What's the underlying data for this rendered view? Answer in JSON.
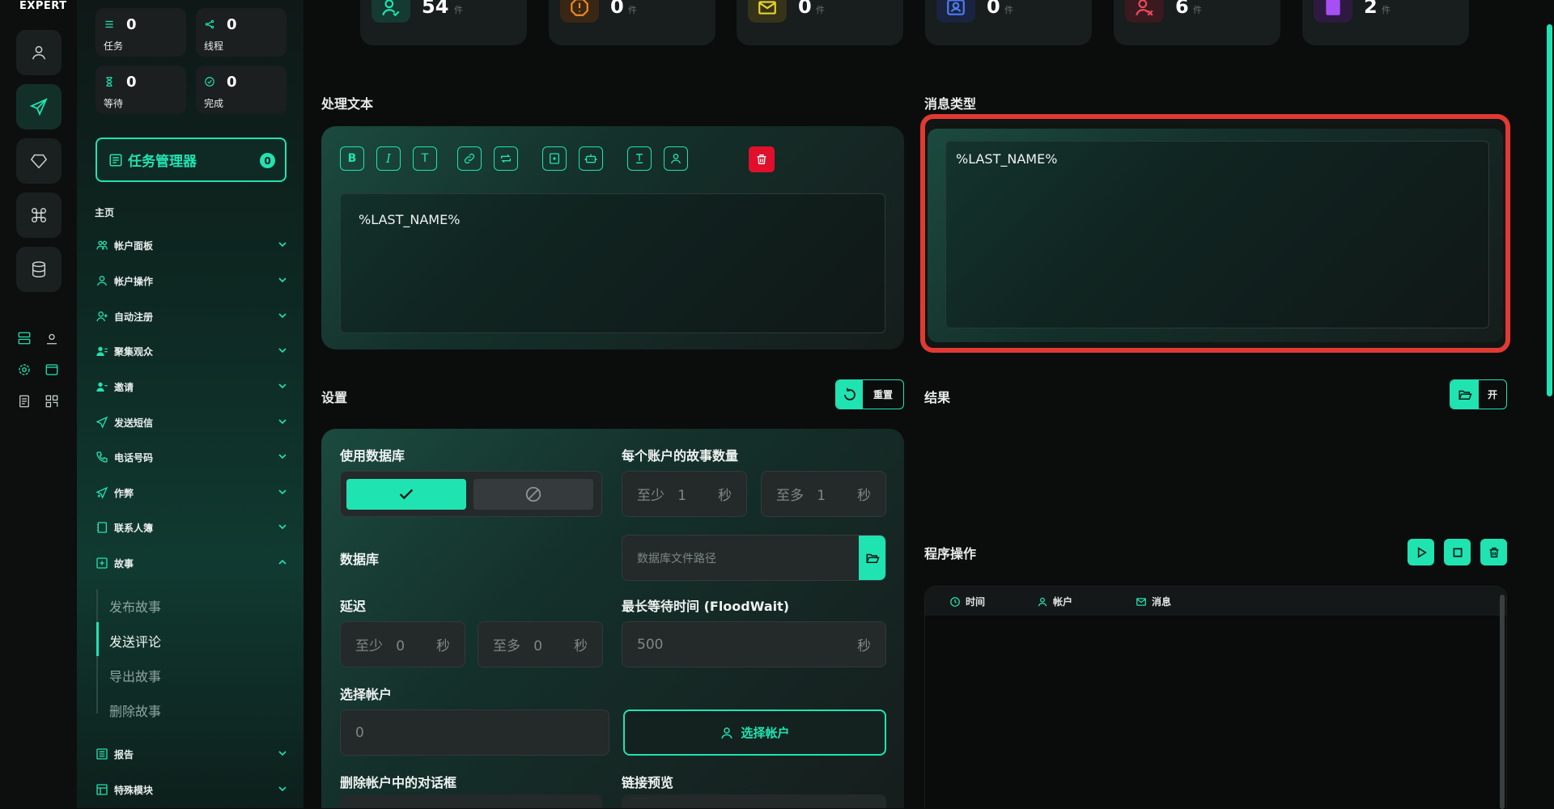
{
  "brand": "EXPERT",
  "sidebar_stats": [
    {
      "value": "0",
      "label": "任务"
    },
    {
      "value": "0",
      "label": "线程"
    },
    {
      "value": "0",
      "label": "等待"
    },
    {
      "value": "0",
      "label": "完成"
    }
  ],
  "task_manager": {
    "label": "任务管理器",
    "badge": "0"
  },
  "nav": {
    "home_label": "主页",
    "items": [
      {
        "label": "帐户面板"
      },
      {
        "label": "帐户操作"
      },
      {
        "label": "自动注册"
      },
      {
        "label": "聚集观众"
      },
      {
        "label": "邀请"
      },
      {
        "label": "发送短信"
      },
      {
        "label": "电话号码"
      },
      {
        "label": "作弊"
      },
      {
        "label": "联系人簿"
      },
      {
        "label": "故事"
      }
    ],
    "story_sub": [
      {
        "label": "发布故事"
      },
      {
        "label": "发送评论"
      },
      {
        "label": "导出故事"
      },
      {
        "label": "删除故事"
      }
    ],
    "bottom_items": [
      {
        "label": "报告"
      },
      {
        "label": "特殊模块"
      }
    ]
  },
  "top_stats": [
    {
      "value": "54",
      "unit": "件",
      "color": "#20e3b2"
    },
    {
      "value": "0",
      "unit": "件",
      "color": "#f08a24"
    },
    {
      "value": "0",
      "unit": "件",
      "color": "#e8d22a"
    },
    {
      "value": "0",
      "unit": "件",
      "color": "#4f7cf5"
    },
    {
      "value": "6",
      "unit": "件",
      "color": "#ee4b5a"
    },
    {
      "value": "2",
      "unit": "件",
      "color": "#a64ff5"
    }
  ],
  "process_text": {
    "title": "处理文本",
    "content": "%LAST_NAME%",
    "toolbar": [
      "bold-icon",
      "italic-icon",
      "text-icon",
      "link-icon",
      "repeat-icon",
      "file-add-icon",
      "robot-icon",
      "format-icon",
      "user-icon",
      "trash-icon"
    ]
  },
  "message_type": {
    "title": "消息类型",
    "content": "%LAST_NAME%"
  },
  "settings": {
    "title": "设置",
    "reset_label": "重置",
    "use_db_label": "使用数据库",
    "stories_per_account_label": "每个账户的故事数量",
    "min_prefix": "至少",
    "max_prefix": "至多",
    "story_min": "1",
    "story_max": "1",
    "sec_unit": "秒",
    "database_label": "数据库",
    "database_placeholder": "数据库文件路径",
    "delay_label": "延迟",
    "delay_min": "0",
    "delay_max": "0",
    "floodwait_label": "最长等待时间 (FloodWait)",
    "floodwait_value": "500",
    "select_accounts_label": "选择帐户",
    "select_accounts_value": "0",
    "select_accounts_button": "选择帐户",
    "delete_dialogs_label": "删除帐户中的对话框",
    "link_preview_label": "链接预览"
  },
  "results": {
    "title": "结果",
    "open_label": "开"
  },
  "program_ops": {
    "title": "程序操作",
    "columns": [
      "时间",
      "帐户",
      "消息"
    ]
  },
  "colors": {
    "accent": "#20e3b2",
    "highlight": "#e03a33"
  }
}
